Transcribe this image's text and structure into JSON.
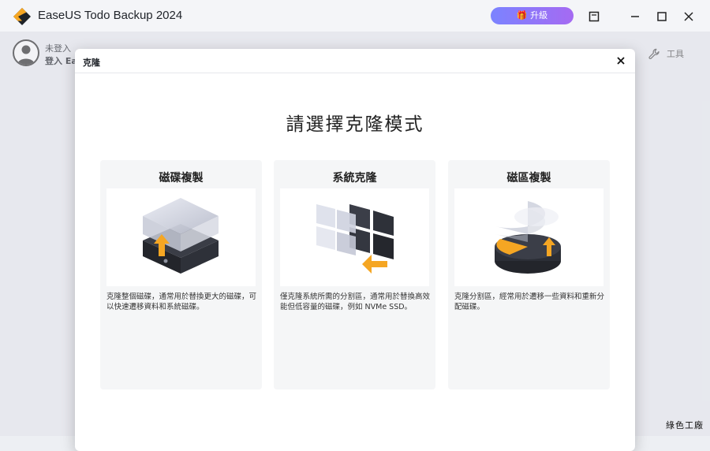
{
  "app": {
    "title": "EaseUS Todo Backup 2024",
    "upgrade_label": "升級",
    "user_status": "未登入",
    "login_label": "登入 EaseUS",
    "tools_label": "工具",
    "watermark": "綠色工廠"
  },
  "dialog": {
    "title": "克隆",
    "heading": "請選擇克隆模式",
    "cards": [
      {
        "title": "磁碟複製",
        "illustration": "disk-clone-icon",
        "description": "克隆整個磁碟，通常用於替換更大的磁碟，可以快速遷移資料和系統磁碟。"
      },
      {
        "title": "系統克隆",
        "illustration": "system-clone-icon",
        "description": "僅克隆系統所需的分割區，通常用於替換高效能但低容量的磁碟，例如 NVMe SSD。"
      },
      {
        "title": "磁區複製",
        "illustration": "partition-clone-icon",
        "description": "克隆分割區，經常用於遷移一些資料和重新分配磁碟。"
      }
    ]
  },
  "colors": {
    "accent_orange": "#f5a623",
    "dark_disk": "#2b2e36",
    "upgrade_gradient_start": "#7b83ff",
    "upgrade_gradient_end": "#a56af2"
  }
}
